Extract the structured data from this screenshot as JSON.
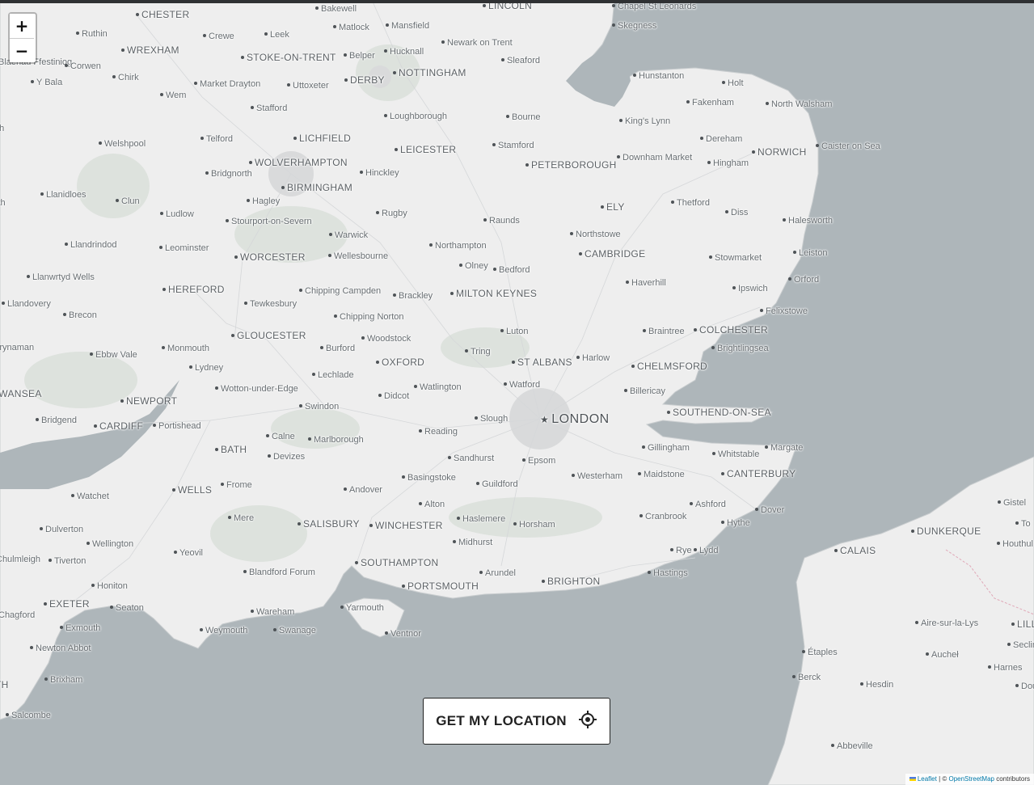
{
  "map": {
    "colors": {
      "sea": "#aeb6ba",
      "land": "#eeeeee",
      "park": "#dde2dd",
      "label": "#666c70"
    },
    "places": [
      {
        "name": "CHESTER",
        "type": "city"
      },
      {
        "name": "Bakewell",
        "type": "town"
      },
      {
        "name": "LINCOLN",
        "type": "city"
      },
      {
        "name": "Chapel St Leonards",
        "type": "town"
      },
      {
        "name": "Ruthin",
        "type": "town"
      },
      {
        "name": "Crewe",
        "type": "town"
      },
      {
        "name": "Leek",
        "type": "town"
      },
      {
        "name": "Matlock",
        "type": "town"
      },
      {
        "name": "Mansfield",
        "type": "town"
      },
      {
        "name": "Skegness",
        "type": "town"
      },
      {
        "name": "WREXHAM",
        "type": "city"
      },
      {
        "name": "STOKE-ON-TRENT",
        "type": "city"
      },
      {
        "name": "Belper",
        "type": "town"
      },
      {
        "name": "Hucknall",
        "type": "town"
      },
      {
        "name": "Newark on Trent",
        "type": "town"
      },
      {
        "name": "Blaenau Ffestiniog",
        "type": "town"
      },
      {
        "name": "Corwen",
        "type": "town"
      },
      {
        "name": "Sleaford",
        "type": "town"
      },
      {
        "name": "Y Bala",
        "type": "town"
      },
      {
        "name": "Chirk",
        "type": "town"
      },
      {
        "name": "Market Drayton",
        "type": "town"
      },
      {
        "name": "Uttoxeter",
        "type": "town"
      },
      {
        "name": "DERBY",
        "type": "city"
      },
      {
        "name": "NOTTINGHAM",
        "type": "city"
      },
      {
        "name": "Hunstanton",
        "type": "town"
      },
      {
        "name": "Holt",
        "type": "town"
      },
      {
        "name": "Wem",
        "type": "town"
      },
      {
        "name": "Stafford",
        "type": "town"
      },
      {
        "name": "Loughborough",
        "type": "town"
      },
      {
        "name": "Bourne",
        "type": "town"
      },
      {
        "name": "Fakenham",
        "type": "town"
      },
      {
        "name": "North Walsham",
        "type": "town"
      },
      {
        "name": "King's Lynn",
        "type": "town"
      },
      {
        "name": "LICHFIELD",
        "type": "city"
      },
      {
        "name": "Telford",
        "type": "town"
      },
      {
        "name": "Welshpool",
        "type": "town"
      },
      {
        "name": "LEICESTER",
        "type": "city"
      },
      {
        "name": "Stamford",
        "type": "town"
      },
      {
        "name": "Dereham",
        "type": "town"
      },
      {
        "name": "NORWICH",
        "type": "city"
      },
      {
        "name": "Caister on Sea",
        "type": "town"
      },
      {
        "name": "WOLVERHAMPTON",
        "type": "city"
      },
      {
        "name": "Downham Market",
        "type": "town"
      },
      {
        "name": "PETERBOROUGH",
        "type": "city"
      },
      {
        "name": "Hingham",
        "type": "town"
      },
      {
        "name": "Bridgnorth",
        "type": "town"
      },
      {
        "name": "Hinckley",
        "type": "town"
      },
      {
        "name": "BIRMINGHAM",
        "type": "city"
      },
      {
        "name": "Llanidloes",
        "type": "town"
      },
      {
        "name": "Clun",
        "type": "town"
      },
      {
        "name": "Hagley",
        "type": "town"
      },
      {
        "name": "Thetford",
        "type": "town"
      },
      {
        "name": "ELY",
        "type": "city"
      },
      {
        "name": "Diss",
        "type": "town"
      },
      {
        "name": "Ludlow",
        "type": "town"
      },
      {
        "name": "Stourport-on-Severn",
        "type": "town"
      },
      {
        "name": "Rugby",
        "type": "town"
      },
      {
        "name": "Raunds",
        "type": "town"
      },
      {
        "name": "Halesworth",
        "type": "town"
      },
      {
        "name": "Warwick",
        "type": "town"
      },
      {
        "name": "Northstowe",
        "type": "town"
      },
      {
        "name": "Llandrindod",
        "type": "town"
      },
      {
        "name": "Leominster",
        "type": "town"
      },
      {
        "name": "Northampton",
        "type": "town"
      },
      {
        "name": "WORCESTER",
        "type": "city"
      },
      {
        "name": "Wellesbourne",
        "type": "town"
      },
      {
        "name": "CAMBRIDGE",
        "type": "city"
      },
      {
        "name": "Leiston",
        "type": "town"
      },
      {
        "name": "Stowmarket",
        "type": "town"
      },
      {
        "name": "Olney",
        "type": "town"
      },
      {
        "name": "Bedford",
        "type": "town"
      },
      {
        "name": "Llanwrtyd Wells",
        "type": "town"
      },
      {
        "name": "Haverhill",
        "type": "town"
      },
      {
        "name": "Orford",
        "type": "town"
      },
      {
        "name": "HEREFORD",
        "type": "city"
      },
      {
        "name": "Chipping Campden",
        "type": "town"
      },
      {
        "name": "MILTON KEYNES",
        "type": "city"
      },
      {
        "name": "Brackley",
        "type": "town"
      },
      {
        "name": "Ipswich",
        "type": "town"
      },
      {
        "name": "Llandovery",
        "type": "town"
      },
      {
        "name": "Tewkesbury",
        "type": "town"
      },
      {
        "name": "Brecon",
        "type": "town"
      },
      {
        "name": "Chipping Norton",
        "type": "town"
      },
      {
        "name": "Felixstowe",
        "type": "town"
      },
      {
        "name": "COLCHESTER",
        "type": "city"
      },
      {
        "name": "Luton",
        "type": "town"
      },
      {
        "name": "Braintree",
        "type": "town"
      },
      {
        "name": "GLOUCESTER",
        "type": "city"
      },
      {
        "name": "Woodstock",
        "type": "town"
      },
      {
        "name": "Brynaman",
        "type": "town"
      },
      {
        "name": "Monmouth",
        "type": "town"
      },
      {
        "name": "Burford",
        "type": "town"
      },
      {
        "name": "Tring",
        "type": "town"
      },
      {
        "name": "Brightlingsea",
        "type": "town"
      },
      {
        "name": "Ebbw Vale",
        "type": "town"
      },
      {
        "name": "Harlow",
        "type": "town"
      },
      {
        "name": "ST ALBANS",
        "type": "city"
      },
      {
        "name": "OXFORD",
        "type": "city"
      },
      {
        "name": "CHELMSFORD",
        "type": "city"
      },
      {
        "name": "Lydney",
        "type": "town"
      },
      {
        "name": "Lechlade",
        "type": "town"
      },
      {
        "name": "Watford",
        "type": "town"
      },
      {
        "name": "Watlington",
        "type": "town"
      },
      {
        "name": "Wotton-under-Edge",
        "type": "town"
      },
      {
        "name": "SWANSEA",
        "type": "city"
      },
      {
        "name": "Billericay",
        "type": "town"
      },
      {
        "name": "Didcot",
        "type": "town"
      },
      {
        "name": "NEWPORT",
        "type": "city"
      },
      {
        "name": "Swindon",
        "type": "town"
      },
      {
        "name": "SOUTHEND-ON-SEA",
        "type": "city"
      },
      {
        "name": "Bridgend",
        "type": "town"
      },
      {
        "name": "Slough",
        "type": "town"
      },
      {
        "name": "LONDON",
        "type": "capital"
      },
      {
        "name": "CARDIFF",
        "type": "city"
      },
      {
        "name": "Portishead",
        "type": "town"
      },
      {
        "name": "Reading",
        "type": "town"
      },
      {
        "name": "Calne",
        "type": "town"
      },
      {
        "name": "Marlborough",
        "type": "town"
      },
      {
        "name": "Gillingham",
        "type": "town"
      },
      {
        "name": "Margate",
        "type": "town"
      },
      {
        "name": "BATH",
        "type": "city"
      },
      {
        "name": "Whitstable",
        "type": "town"
      },
      {
        "name": "Devizes",
        "type": "town"
      },
      {
        "name": "Sandhurst",
        "type": "town"
      },
      {
        "name": "Epsom",
        "type": "town"
      },
      {
        "name": "Maidstone",
        "type": "town"
      },
      {
        "name": "Westerham",
        "type": "town"
      },
      {
        "name": "CANTERBURY",
        "type": "city"
      },
      {
        "name": "Basingstoke",
        "type": "town"
      },
      {
        "name": "Frome",
        "type": "town"
      },
      {
        "name": "Guildford",
        "type": "town"
      },
      {
        "name": "WELLS",
        "type": "city"
      },
      {
        "name": "Andover",
        "type": "town"
      },
      {
        "name": "Watchet",
        "type": "town"
      },
      {
        "name": "Alton",
        "type": "town"
      },
      {
        "name": "Ashford",
        "type": "town"
      },
      {
        "name": "Dover",
        "type": "town"
      },
      {
        "name": "Cranbrook",
        "type": "town"
      },
      {
        "name": "Mere",
        "type": "town"
      },
      {
        "name": "Haslemere",
        "type": "town"
      },
      {
        "name": "Hythe",
        "type": "town"
      },
      {
        "name": "SALISBURY",
        "type": "city"
      },
      {
        "name": "WINCHESTER",
        "type": "city"
      },
      {
        "name": "Horsham",
        "type": "town"
      },
      {
        "name": "Dulverton",
        "type": "town"
      },
      {
        "name": "Wellington",
        "type": "town"
      },
      {
        "name": "Midhurst",
        "type": "town"
      },
      {
        "name": "Yeovil",
        "type": "town"
      },
      {
        "name": "Rye",
        "type": "town"
      },
      {
        "name": "Lydd",
        "type": "town"
      },
      {
        "name": "Chulmleigh",
        "type": "town"
      },
      {
        "name": "Tiverton",
        "type": "town"
      },
      {
        "name": "SOUTHAMPTON",
        "type": "city"
      },
      {
        "name": "Blandford Forum",
        "type": "town"
      },
      {
        "name": "Arundel",
        "type": "town"
      },
      {
        "name": "Hastings",
        "type": "town"
      },
      {
        "name": "BRIGHTON",
        "type": "city"
      },
      {
        "name": "Honiton",
        "type": "town"
      },
      {
        "name": "PORTSMOUTH",
        "type": "city"
      },
      {
        "name": "EXETER",
        "type": "city"
      },
      {
        "name": "Seaton",
        "type": "town"
      },
      {
        "name": "Yarmouth",
        "type": "town"
      },
      {
        "name": "Wareham",
        "type": "town"
      },
      {
        "name": "Chagford",
        "type": "town"
      },
      {
        "name": "Exmouth",
        "type": "town"
      },
      {
        "name": "Weymouth",
        "type": "town"
      },
      {
        "name": "Swanage",
        "type": "town"
      },
      {
        "name": "Ventnor",
        "type": "town"
      },
      {
        "name": "Newton Abbot",
        "type": "town"
      },
      {
        "name": "Brixham",
        "type": "town"
      },
      {
        "name": "Salcombe",
        "type": "town"
      },
      {
        "name": "Gistel",
        "type": "town"
      },
      {
        "name": "DUNKERQUE",
        "type": "city"
      },
      {
        "name": "Houthul",
        "type": "town"
      },
      {
        "name": "CALAIS",
        "type": "city"
      },
      {
        "name": "Aire-sur-la-Lys",
        "type": "town"
      },
      {
        "name": "LILL",
        "type": "city"
      },
      {
        "name": "Étaples",
        "type": "town"
      },
      {
        "name": "Aucheł",
        "type": "town"
      },
      {
        "name": "Seclin",
        "type": "town"
      },
      {
        "name": "Harnes",
        "type": "town"
      },
      {
        "name": "Berck",
        "type": "town"
      },
      {
        "name": "Hesdin",
        "type": "town"
      },
      {
        "name": "Dou",
        "type": "town"
      },
      {
        "name": "Abbeville",
        "type": "town"
      },
      {
        "name": "To",
        "type": "town"
      },
      {
        "name": "uth",
        "type": "town"
      },
      {
        "name": "yth",
        "type": "town"
      },
      {
        "name": "TH",
        "type": "city"
      },
      {
        "name": "r",
        "type": "town"
      }
    ]
  },
  "zoom": {
    "in_label": "+",
    "out_label": "−"
  },
  "location_button": {
    "label": "GET MY LOCATION",
    "icon": "crosshair-icon"
  },
  "attribution": {
    "leaflet": "Leaflet",
    "separator": " | © ",
    "osm": "OpenStreetMap",
    "suffix": " contributors"
  }
}
